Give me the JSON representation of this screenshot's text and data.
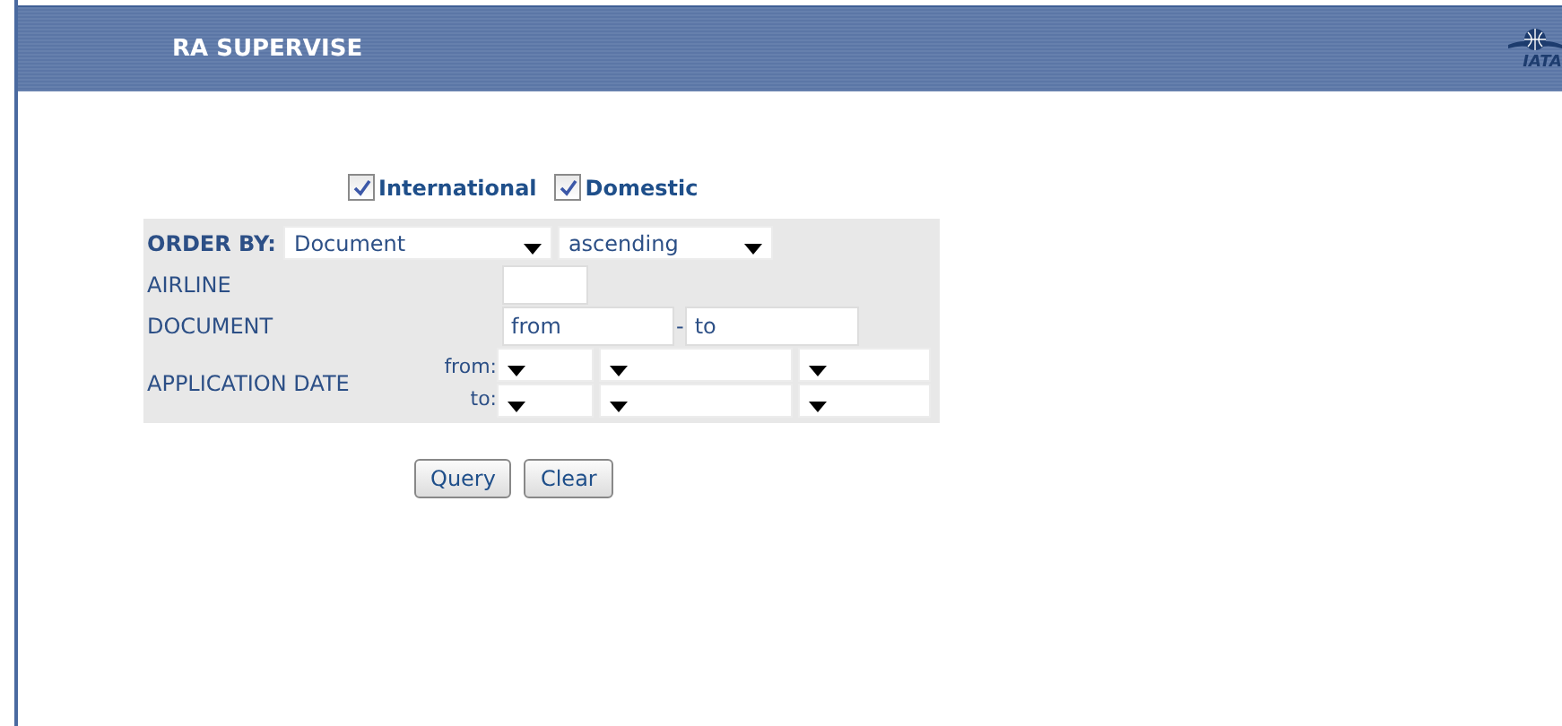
{
  "header": {
    "title": "RA SUPERVISE",
    "logo_text": "IATA"
  },
  "filters": [
    {
      "label": "International",
      "checked": true
    },
    {
      "label": "Domestic",
      "checked": true
    }
  ],
  "order_by": {
    "label": "ORDER BY:",
    "field": "Document",
    "direction": "ascending"
  },
  "airline": {
    "label": "AIRLINE"
  },
  "document": {
    "label": "DOCUMENT",
    "from": "from",
    "separator": "-",
    "to": "to"
  },
  "application_date": {
    "label": "APPLICATION DATE",
    "from_label": "from:",
    "to_label": "to:"
  },
  "buttons": [
    "Query",
    "Clear"
  ]
}
